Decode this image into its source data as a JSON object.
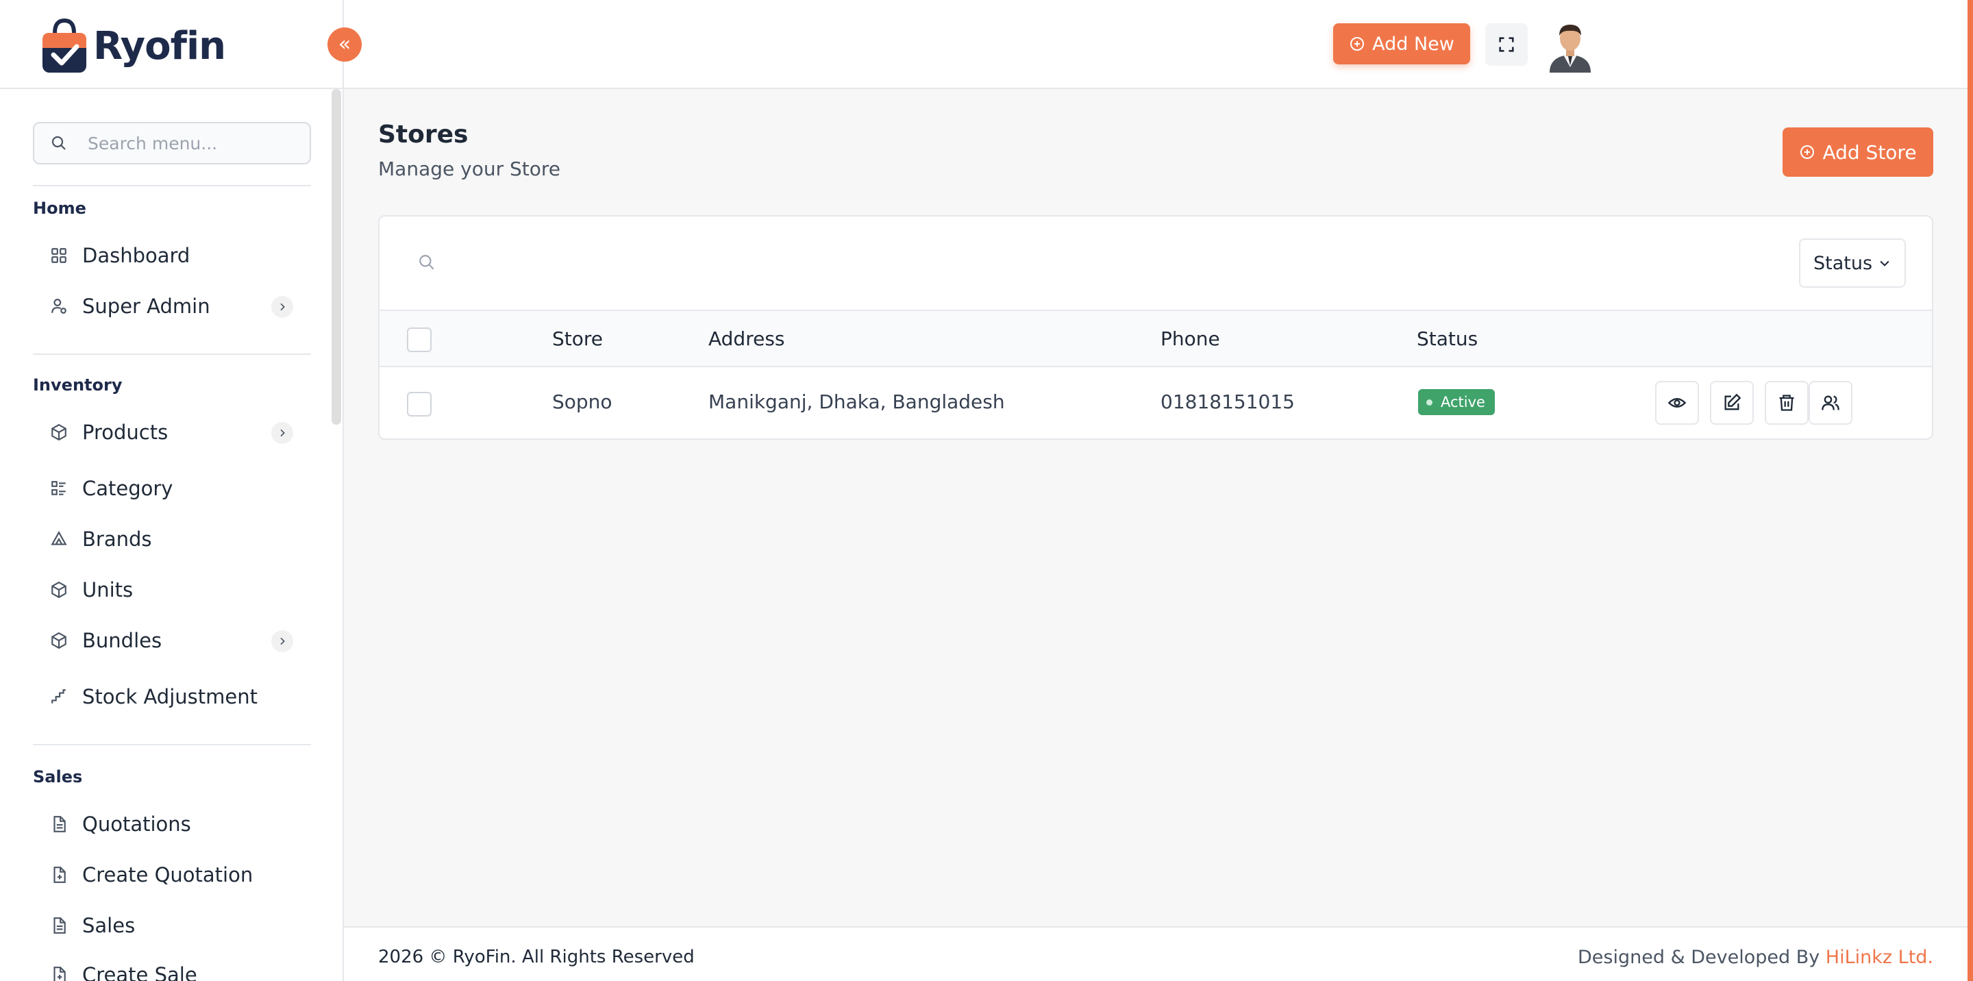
{
  "brand": {
    "name": "Ryofin",
    "accent": "#f0764a",
    "navy": "#1e2a4a"
  },
  "sidebar": {
    "search_placeholder": "Search menu...",
    "sections": {
      "home": {
        "label": "Home",
        "items": [
          {
            "label": "Dashboard",
            "icon": "grid-icon"
          },
          {
            "label": "Super Admin",
            "icon": "user-gear-icon",
            "has_children": true
          }
        ]
      },
      "inventory": {
        "label": "Inventory",
        "items": [
          {
            "label": "Products",
            "icon": "box-icon",
            "has_children": true
          },
          {
            "label": "Category",
            "icon": "category-list-icon"
          },
          {
            "label": "Brands",
            "icon": "brand-icon"
          },
          {
            "label": "Units",
            "icon": "box-icon"
          },
          {
            "label": "Bundles",
            "icon": "box-icon",
            "has_children": true
          },
          {
            "label": "Stock Adjustment",
            "icon": "stairs-icon"
          }
        ]
      },
      "sales": {
        "label": "Sales",
        "items": [
          {
            "label": "Quotations",
            "icon": "file-icon"
          },
          {
            "label": "Create Quotation",
            "icon": "file-plus-icon"
          },
          {
            "label": "Sales",
            "icon": "file-icon"
          },
          {
            "label": "Create Sale",
            "icon": "file-plus-icon"
          }
        ]
      }
    }
  },
  "header": {
    "add_new_label": "Add New"
  },
  "page": {
    "title": "Stores",
    "subtitle": "Manage your Store",
    "add_store_label": "Add Store"
  },
  "table": {
    "status_filter_label": "Status",
    "columns": [
      "Store",
      "Address",
      "Phone",
      "Status"
    ],
    "rows": [
      {
        "store": "Sopno",
        "address": "Manikganj, Dhaka, Bangladesh",
        "phone": "01818151015",
        "status": "Active"
      }
    ],
    "row_actions": [
      "eye-icon",
      "edit-icon",
      "trash-icon",
      "users-icon"
    ]
  },
  "footer": {
    "copyright": "2026 © RyoFin. All Rights Reserved",
    "credit_prefix": "Designed & Developed By",
    "credit_brand": "HiLinkz Ltd."
  }
}
